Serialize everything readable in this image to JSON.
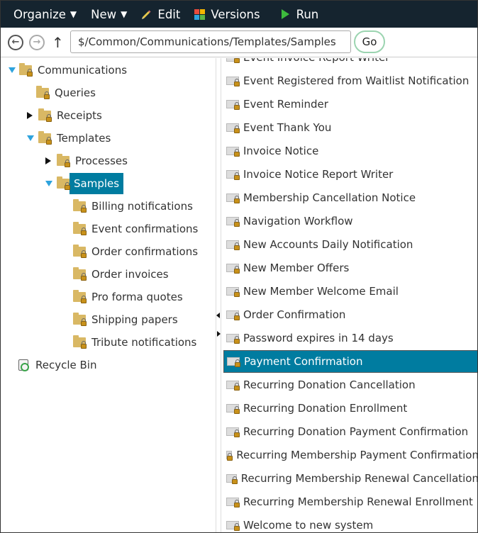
{
  "toolbar": {
    "organize_label": "Organize",
    "new_label": "New",
    "edit_label": "Edit",
    "versions_label": "Versions",
    "run_label": "Run"
  },
  "address": {
    "path": "$/Common/Communications/Templates/Samples",
    "go_label": "Go"
  },
  "tree": {
    "communications": "Communications",
    "queries": "Queries",
    "receipts": "Receipts",
    "templates": "Templates",
    "processes": "Processes",
    "samples": "Samples",
    "billing": "Billing notifications",
    "event_conf": "Event confirmations",
    "order_conf": "Order confirmations",
    "order_inv": "Order invoices",
    "pro_forma": "Pro forma quotes",
    "shipping": "Shipping papers",
    "tribute": "Tribute notifications",
    "recycle": "Recycle Bin"
  },
  "list": [
    "Event Invoice Report Writer",
    "Event Registered from Waitlist Notification",
    "Event Reminder",
    "Event Thank You",
    "Invoice Notice",
    "Invoice Notice Report Writer",
    "Membership Cancellation Notice",
    "Navigation Workflow",
    "New Accounts Daily Notification",
    "New Member Offers",
    "New Member Welcome Email",
    "Order Confirmation",
    "Password expires in 14 days",
    "Payment Confirmation",
    "Recurring Donation Cancellation",
    "Recurring Donation Enrollment",
    "Recurring Donation Payment Confirmation",
    "Recurring Membership Payment Confirmation",
    "Recurring Membership Renewal Cancellation",
    "Recurring Membership Renewal Enrollment",
    "Welcome to new system"
  ],
  "selected_list_item": "Payment Confirmation",
  "colors": {
    "toolbar_bg": "#15242f",
    "selection": "#007ca0",
    "folder": "#d9b864",
    "tree_expand": "#2ea3dd"
  }
}
